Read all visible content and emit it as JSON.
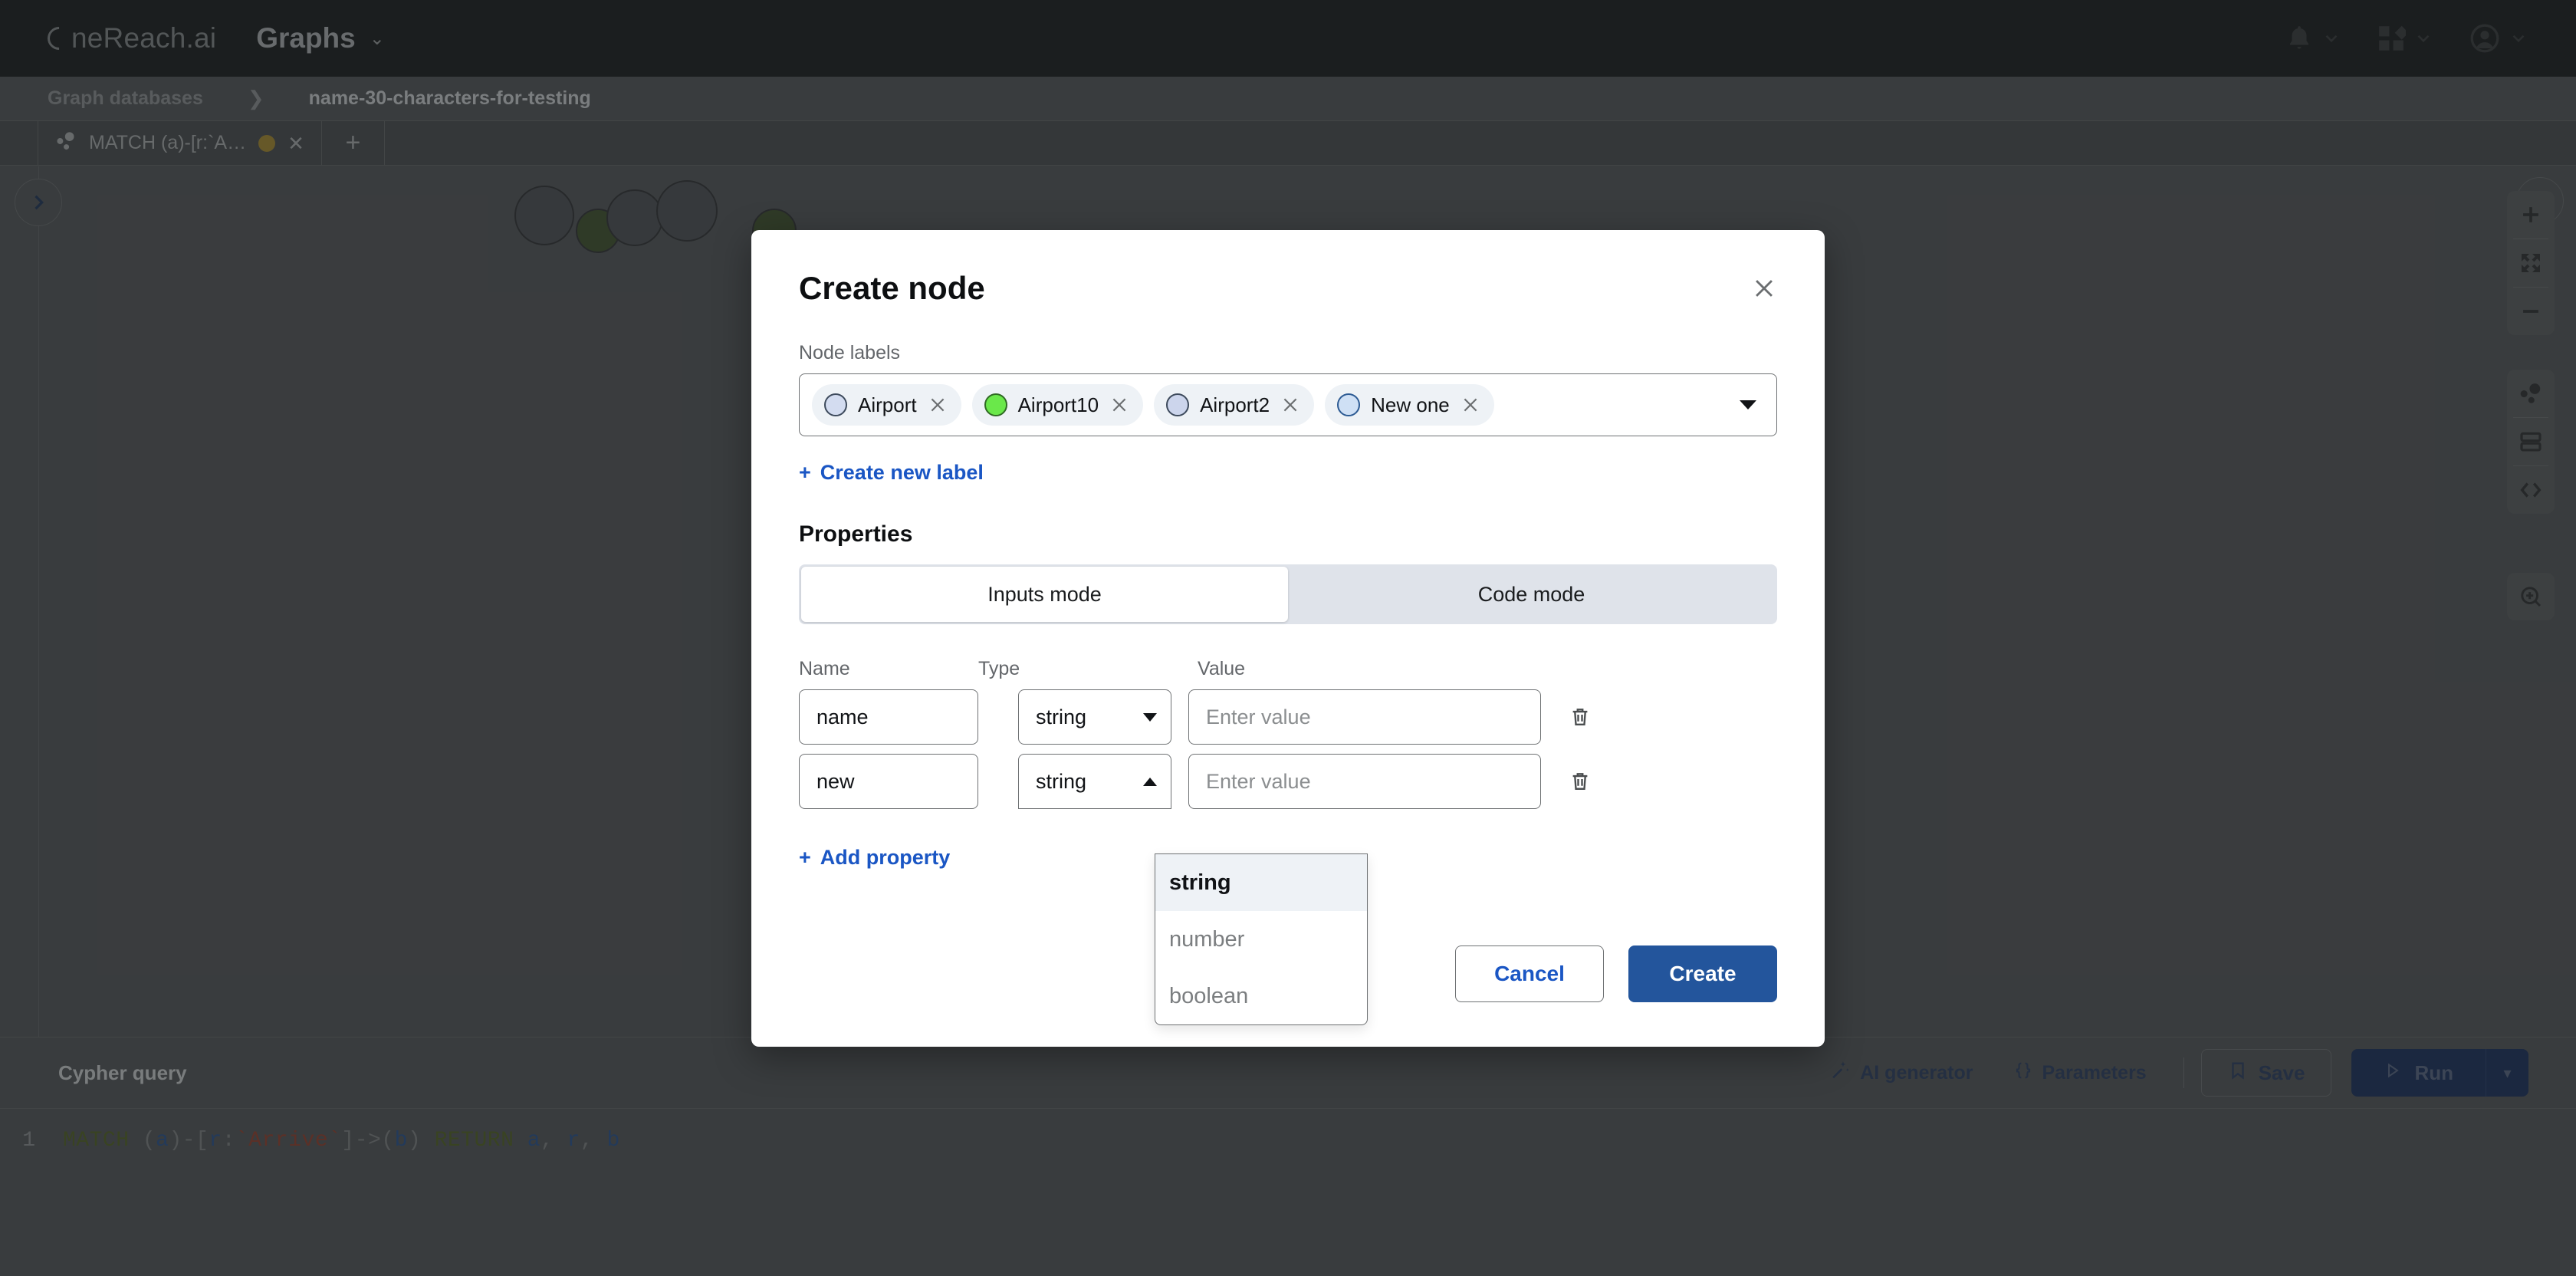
{
  "topnav": {
    "brand": "neReach.ai",
    "app_title": "Graphs",
    "caret": "⌄",
    "icons": [
      {
        "name": "notifications-bell-icon",
        "caret": "⌄"
      },
      {
        "name": "apps-grid-icon",
        "caret": "⌄"
      },
      {
        "name": "user-account-icon",
        "caret": "⌄"
      }
    ]
  },
  "breadcrumb": {
    "root": "Graph databases",
    "separator": "❯",
    "current": "name-30-characters-for-testing"
  },
  "tabs": {
    "query_tab_label": "MATCH (a)-[r:`A…",
    "query_tab_dot_color": "#8a7430",
    "close_label": "✕",
    "add_label": "+"
  },
  "canvas": {
    "left_toggle": "❯",
    "right_toggle": "❮",
    "zoom_controls": [
      {
        "name": "zoom-in-icon",
        "label": "+"
      },
      {
        "name": "fit-to-screen-icon",
        "label": "⛶"
      },
      {
        "name": "zoom-out-icon",
        "label": "−"
      }
    ],
    "view_controls": [
      {
        "name": "graph-view-icon"
      },
      {
        "name": "table-view-icon"
      },
      {
        "name": "code-view-icon"
      }
    ],
    "extra_control": {
      "name": "zoom-target-icon"
    }
  },
  "cypher": {
    "title": "Cypher query",
    "ai_generator": "AI generator",
    "parameters": "Parameters",
    "save": "Save",
    "run": "Run",
    "run_caret": "▾",
    "line_number": "1",
    "query_tokens": [
      {
        "t": "MATCH ",
        "c": "kw"
      },
      {
        "t": "(",
        "c": "pct"
      },
      {
        "t": "a",
        "c": "var"
      },
      {
        "t": ")-[",
        "c": "pct"
      },
      {
        "t": "r",
        "c": "var"
      },
      {
        "t": ":",
        "c": "pct"
      },
      {
        "t": "`Arrive`",
        "c": "rel"
      },
      {
        "t": "]->(",
        "c": "pct"
      },
      {
        "t": "b",
        "c": "var"
      },
      {
        "t": ") ",
        "c": "pct"
      },
      {
        "t": "RETURN ",
        "c": "kw"
      },
      {
        "t": "a",
        "c": "var"
      },
      {
        "t": ", ",
        "c": "pct"
      },
      {
        "t": "r",
        "c": "var"
      },
      {
        "t": ", ",
        "c": "pct"
      },
      {
        "t": "b",
        "c": "var"
      }
    ]
  },
  "modal": {
    "title": "Create node",
    "close_label": "✕",
    "node_labels_label": "Node labels",
    "chips": [
      {
        "label": "Airport",
        "color": "#d3dcf0",
        "border": "#3d4a5c",
        "remove": "✕"
      },
      {
        "label": "Airport10",
        "color": "#6ae84a",
        "border": "#2f6a23",
        "remove": "✕"
      },
      {
        "label": "Airport2",
        "color": "#ccd5ec",
        "border": "#3d4a5c",
        "remove": "✕"
      },
      {
        "label": "New one",
        "color": "#cfe0f5",
        "border": "#2c5a93",
        "remove": "✕"
      }
    ],
    "create_new_label": "Create new label",
    "create_new_label_plus": "+",
    "properties_title": "Properties",
    "modes": [
      {
        "label": "Inputs mode",
        "active": true
      },
      {
        "label": "Code mode",
        "active": false
      }
    ],
    "columns": {
      "name": "Name",
      "type": "Type",
      "value": "Value"
    },
    "rows": [
      {
        "name": "name",
        "type": "string",
        "value": "",
        "value_placeholder": "Enter value",
        "open": false
      },
      {
        "name": "new",
        "type": "string",
        "value": "",
        "value_placeholder": "Enter value",
        "open": true
      }
    ],
    "type_options": [
      {
        "label": "string",
        "selected": true
      },
      {
        "label": "number",
        "selected": false
      },
      {
        "label": "boolean",
        "selected": false
      }
    ],
    "add_property": "Add property",
    "add_property_plus": "+",
    "cancel": "Cancel",
    "create": "Create",
    "accent_blue": "#1a56c4",
    "primary_button": "#23559c"
  }
}
